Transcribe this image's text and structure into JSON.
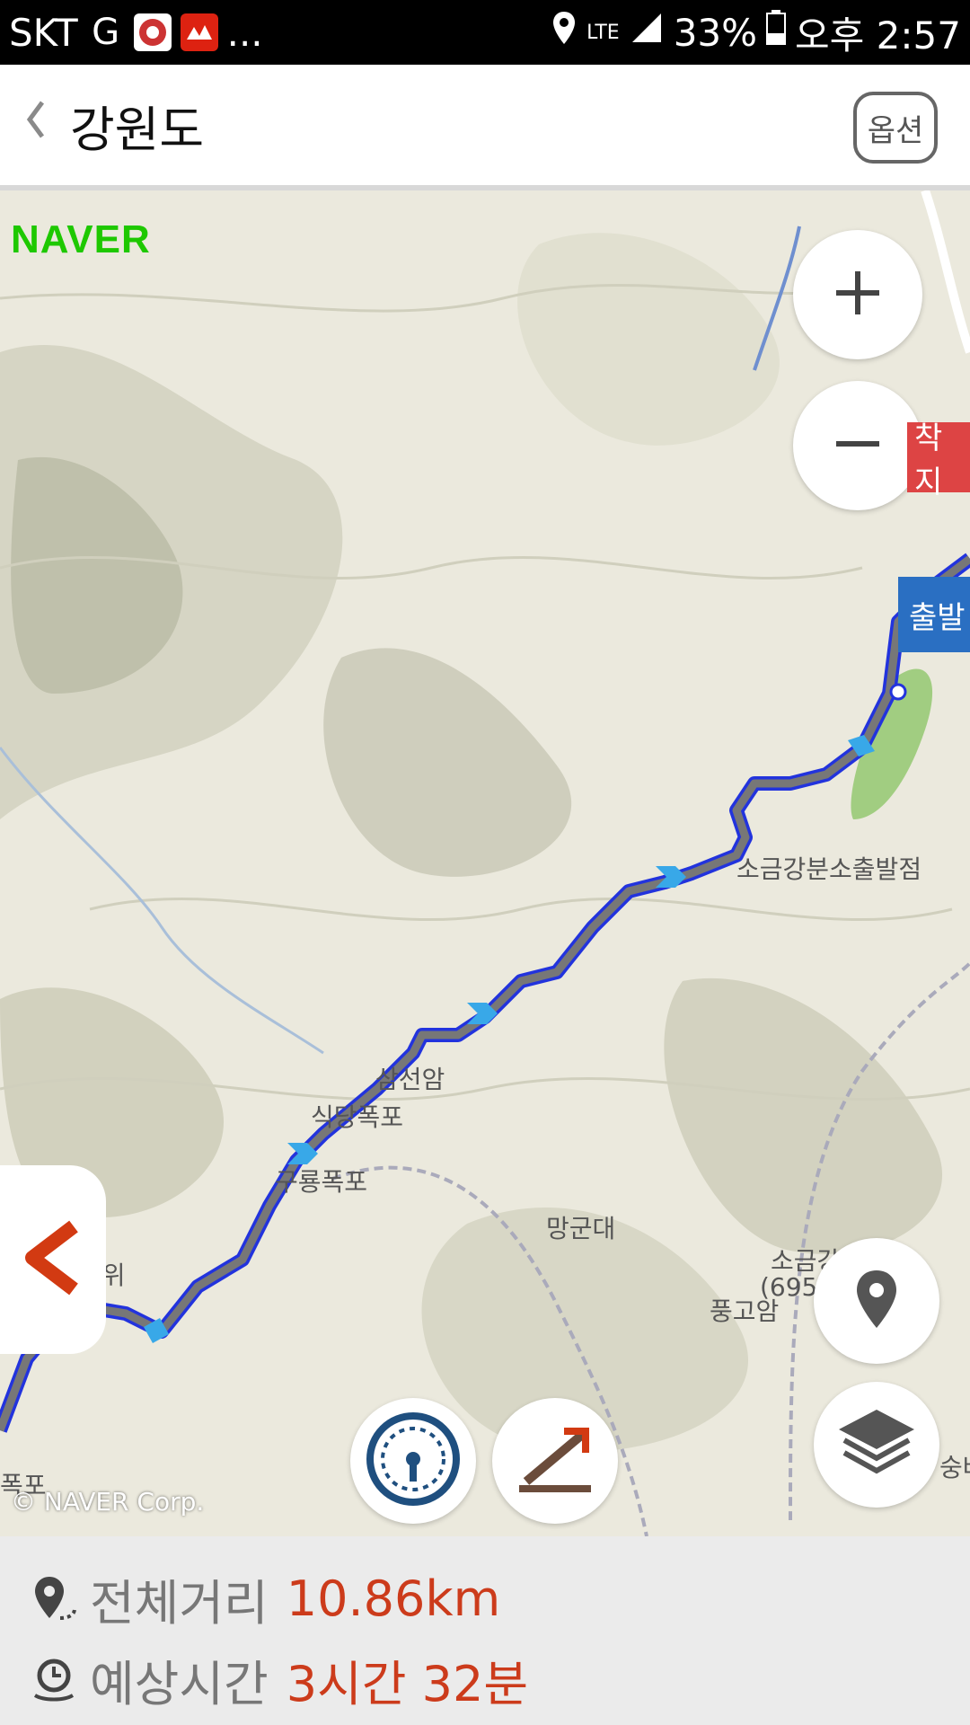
{
  "status_bar": {
    "carrier": "SKT",
    "more": "...",
    "network": "LTE",
    "battery": "33%",
    "time": "오후 2:57"
  },
  "header": {
    "back_icon": "chevron-left-icon",
    "title": "강원도",
    "options_label": "옵션"
  },
  "map": {
    "provider_logo": "NAVER",
    "copyright": "© NAVER Corp.",
    "end_flag": "착지",
    "start_flag": "출발",
    "labels": {
      "branch": "소금강분소출발점",
      "samseonam": "삼선암",
      "fall1": "식당폭포",
      "guryong": "구룡폭포",
      "manggundae": "망군대",
      "bawi": "바위",
      "peak": "소금강",
      "peak_height": "(695.7m)",
      "punggoam": "풍고암",
      "fall_left": "폭포",
      "right_edge": "숭바"
    }
  },
  "route": {
    "total_distance_label": "전체거리",
    "total_distance_value": "10.86km",
    "estimated_time_label": "예상시간",
    "estimated_time_value": "3시간 32분"
  },
  "colors": {
    "route_line": "#2233dd",
    "route_fill": "#777777",
    "accent_red": "#cc3b1b",
    "naver_green": "#1ec800"
  }
}
